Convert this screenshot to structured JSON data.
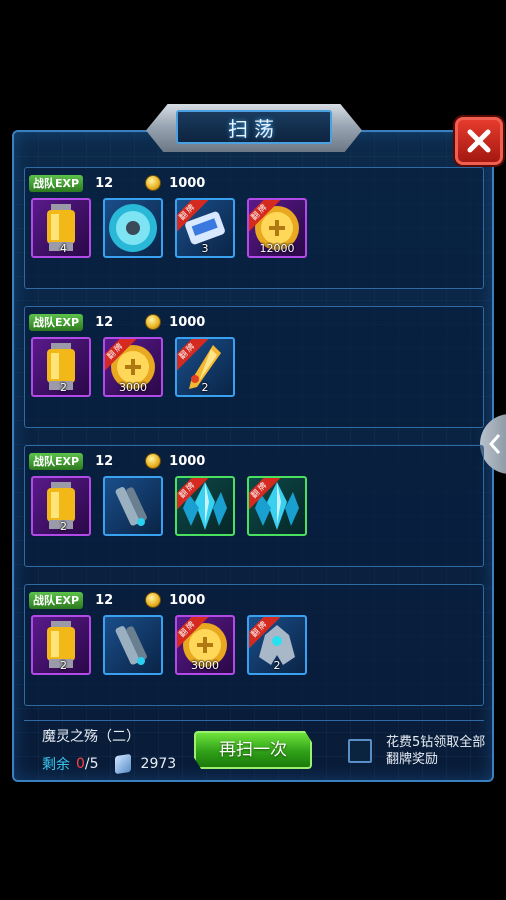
{
  "title": "扫荡",
  "rows": [
    {
      "exp_label": "战队EXP",
      "exp": "12",
      "coins": "1000",
      "items": [
        {
          "icon": "energy-canister",
          "count": "4",
          "frame": "purple",
          "limited": false
        },
        {
          "icon": "shield-core",
          "count": "",
          "frame": "blue",
          "limited": false
        },
        {
          "icon": "data-chip",
          "count": "3",
          "frame": "blue",
          "limited": true
        },
        {
          "icon": "gold-coin",
          "count": "12000",
          "frame": "purple",
          "limited": true
        }
      ]
    },
    {
      "exp_label": "战队EXP",
      "exp": "12",
      "coins": "1000",
      "items": [
        {
          "icon": "energy-canister",
          "count": "2",
          "frame": "purple",
          "limited": false
        },
        {
          "icon": "gold-coin",
          "count": "3000",
          "frame": "purple",
          "limited": true
        },
        {
          "icon": "golden-blade",
          "count": "2",
          "frame": "blue",
          "limited": true
        }
      ]
    },
    {
      "exp_label": "战队EXP",
      "exp": "12",
      "coins": "1000",
      "items": [
        {
          "icon": "energy-canister",
          "count": "2",
          "frame": "purple",
          "limited": false
        },
        {
          "icon": "mech-arm",
          "count": "",
          "frame": "blue",
          "limited": false
        },
        {
          "icon": "crystal",
          "count": "",
          "frame": "green",
          "limited": true
        },
        {
          "icon": "crystal",
          "count": "",
          "frame": "green",
          "limited": true
        }
      ]
    },
    {
      "exp_label": "战队EXP",
      "exp": "12",
      "coins": "1000",
      "items": [
        {
          "icon": "energy-canister",
          "count": "2",
          "frame": "purple",
          "limited": false
        },
        {
          "icon": "mech-arm",
          "count": "",
          "frame": "blue",
          "limited": false
        },
        {
          "icon": "gold-coin",
          "count": "3000",
          "frame": "purple",
          "limited": true
        },
        {
          "icon": "mech-suit",
          "count": "2",
          "frame": "blue",
          "limited": true
        }
      ]
    }
  ],
  "limited_ribbon": "翻牌",
  "footer": {
    "stage_name": "魔灵之殇（二）",
    "remaining_label": "剩余",
    "remaining_current": "0",
    "remaining_max": "/5",
    "tickets": "2973",
    "again_button": "再扫一次",
    "option_label": "花费5钻领取全部翻牌奖励"
  }
}
